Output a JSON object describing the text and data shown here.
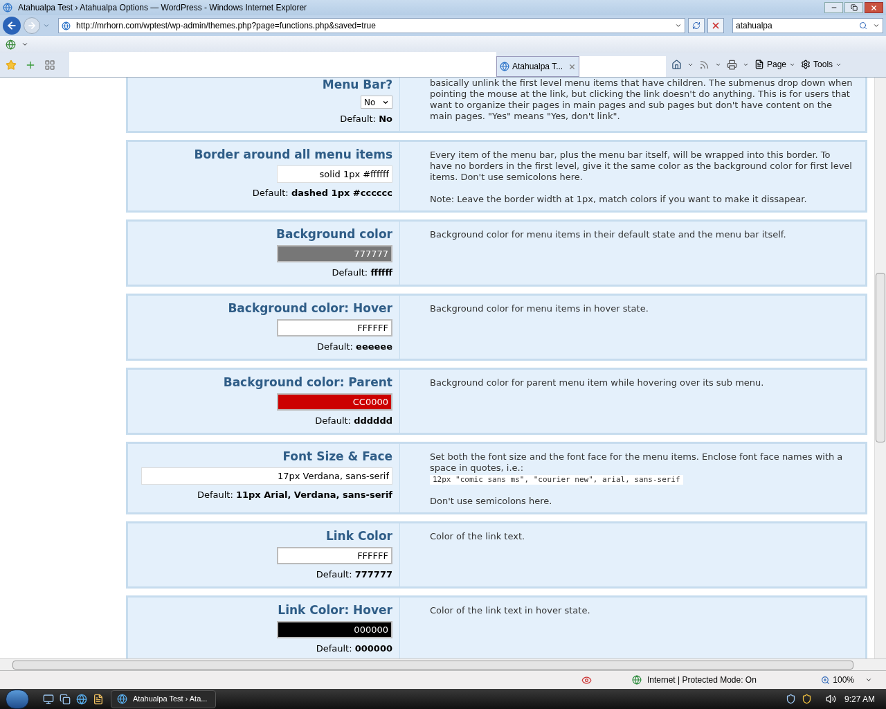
{
  "window": {
    "title": "Atahualpa Test › Atahualpa Options — WordPress - Windows Internet Explorer"
  },
  "address_bar": {
    "url": "http://mrhorn.com/wptest/wp-admin/themes.php?page=functions.php&saved=true"
  },
  "search": {
    "value": "atahualpa"
  },
  "tabs": [
    {
      "label": "Atahualpa T...",
      "selected": true
    }
  ],
  "toolbar": {
    "page_menu": "Page",
    "tools_menu": "Tools"
  },
  "options": [
    {
      "title": "Menu Bar?",
      "kind": "select",
      "value": "No",
      "default_label": "Default:",
      "default": "No",
      "description": [
        {
          "kind": "text",
          "text": "basically unlink the first level menu items that have children. The submenus drop down when pointing the mouse at the link, but clicking the link doesn't do anything. This is for users that want to organize their pages in main pages and sub pages but don't have content on the main pages. \"Yes\" means \"Yes, don't link\"."
        }
      ]
    },
    {
      "title": "Border around all menu items",
      "kind": "text",
      "wide": false,
      "value": "solid 1px #ffffff",
      "default_label": "Default:",
      "default": "dashed 1px #cccccc",
      "description": [
        {
          "kind": "text",
          "text": "Every item of the menu bar, plus the menu bar itself, will be wrapped into this border. To have no borders in the first level, give it the same color as the background color for first level items. Don't use semicolons here."
        },
        {
          "kind": "text",
          "text": "Note: Leave the border width at 1px, match colors if you want to make it dissapear."
        }
      ]
    },
    {
      "title": "Background color",
      "kind": "color",
      "value": "777777",
      "color": "#777777",
      "default_label": "Default:",
      "default": "ffffff",
      "description": [
        {
          "kind": "text",
          "text": "Background color for menu items in their default state and the menu bar itself."
        }
      ]
    },
    {
      "title": "Background color: Hover",
      "kind": "color",
      "value": "FFFFFF",
      "color": "#ffffff",
      "default_label": "Default:",
      "default": "eeeeee",
      "description": [
        {
          "kind": "text",
          "text": "Background color for menu items in hover state."
        }
      ]
    },
    {
      "title": "Background color: Parent",
      "kind": "color",
      "value": "CC0000",
      "color": "#cc0000",
      "default_label": "Default:",
      "default": "dddddd",
      "description": [
        {
          "kind": "text",
          "text": "Background color for parent menu item while hovering over its sub menu."
        }
      ]
    },
    {
      "title": "Font Size & Face",
      "kind": "text",
      "wide": true,
      "value": "17px Verdana, sans-serif",
      "default_label": "Default:",
      "default": "11px Arial, Verdana, sans-serif",
      "description": [
        {
          "kind": "text",
          "text": "Set both the font size and the font face for the menu items. Enclose font face names with a space in quotes, i.e.:"
        },
        {
          "kind": "code",
          "text": "12px \"comic sans ms\", \"courier new\", arial, sans-serif"
        },
        {
          "kind": "text",
          "text": "Don't use semicolons here."
        }
      ]
    },
    {
      "title": "Link Color",
      "kind": "color",
      "value": "FFFFFF",
      "color": "#ffffff",
      "default_label": "Default:",
      "default": "777777",
      "description": [
        {
          "kind": "text",
          "text": "Color of the link text."
        }
      ]
    },
    {
      "title": "Link Color: Hover",
      "kind": "color",
      "value": "000000",
      "color": "#000000",
      "default_label": "Default:",
      "default": "000000",
      "description": [
        {
          "kind": "text",
          "text": "Color of the link text in hover state."
        }
      ]
    }
  ],
  "status_bar": {
    "zone": "Internet | Protected Mode: On",
    "zoom": "100%"
  },
  "taskbar": {
    "task": "Atahualpa Test › Ata...",
    "clock": "9:27 AM"
  }
}
